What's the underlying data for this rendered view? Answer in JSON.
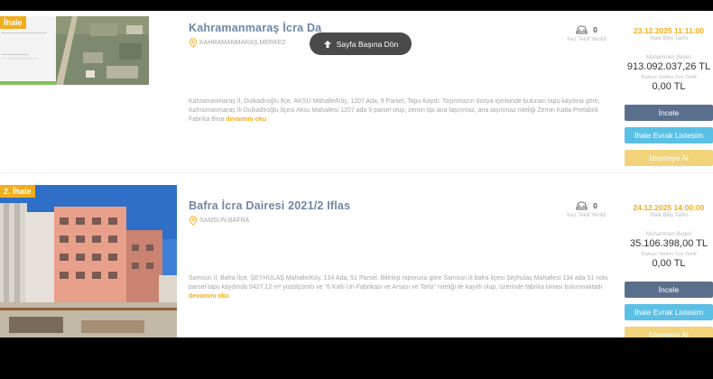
{
  "scroll_top_label": "Sayfa Başına Dön",
  "listings": [
    {
      "badge": "İhale",
      "title": "Kahramanmaraş İcra Da",
      "location": "KAHRAMANMARAŞ,MERKEZ",
      "description": "Kahramanmaraş İl, Dulkadiroğlu İlçe, AKSU Mahalle/Köy, 1207 Ada, 9 Parsel, Tapu Kaydı: Taşınmazın dosya içerisinde bulunan tapu kaydına göre, Kahramanmaraş İli Dulkadiroğlu İlçesi Aksu Mahallesi 1207 ada 9 parsel olup, zemin tipi ana taşınmaz, ana taşınmaz niteliği Zemin Katta Prefabrik Fabrika Bina",
      "more_label": "devamını oku",
      "offer_count": "0",
      "offer_label": "Kez Teklif Verildi",
      "end_date": "23.12.2025 11:11:00",
      "end_date_label": "İhale Bitiş Tarihi",
      "estimated_label": "Muhammen Bedeli",
      "estimated_value": "913.092.037,26 TL",
      "last_offer_label": "İhaleye Verilen Son Teklif",
      "last_offer_value": "0,00 TL",
      "inspect_label": "İncele",
      "documents_label": "İhale Evrak Listesim",
      "watch_label": "İzlemeye Al"
    },
    {
      "badge": "2. İhale",
      "title": "Bafra İcra Dairesi 2021/2 Iflas",
      "location": "SAMSUN,BAFRA",
      "description": "Samsun İl, Bafra İlçe, ŞEYHULAŞ Mahalle/Köy, 134 Ada, 51 Parsel, Bilirkişi raporuna göre Samsun ili bafra ilçesi Şeyhulaş Mahallesi 134 ada 51 nolu parsel tapu kaydında 9427,12 m² yüzölçümlü ve \"6 Katlı Un Fabrikası ve Arsası ve Tarla\" niteliği ile kayıtlı olup, üzerinde fabrika binası bulunmaktadı",
      "more_label": "devamını oku",
      "offer_count": "0",
      "offer_label": "Kez Teklif Verildi",
      "end_date": "24.12.2025 14:00:00",
      "end_date_label": "İhale Bitiş Tarihi",
      "estimated_label": "Muhammen Bedeli",
      "estimated_value": "35.106.398,00 TL",
      "last_offer_label": "İhaleye Verilen Son Teklif",
      "last_offer_value": "0,00 TL",
      "inspect_label": "İncele",
      "documents_label": "İhale Evrak Listesim",
      "watch_label": "İzlemeye Al"
    }
  ],
  "colors": {
    "title": "#6f86a6",
    "accent": "#f0ad1e",
    "inspect_button": "#5a6f8c",
    "documents_button": "#5bc0e5",
    "watch_button": "#f2d37a"
  }
}
